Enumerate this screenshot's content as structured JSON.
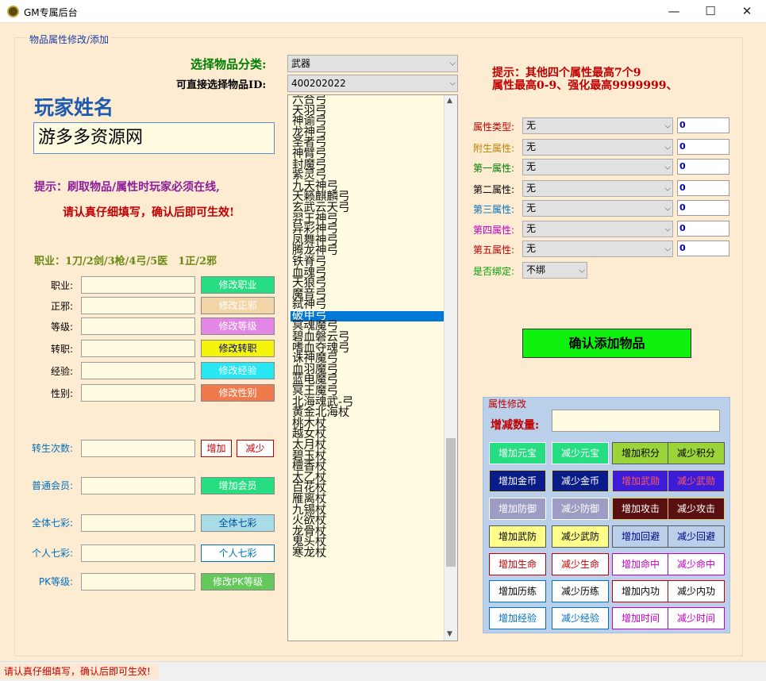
{
  "window": {
    "title": "GM专属后台",
    "minimize": "—",
    "maximize": "☐",
    "close": "✕"
  },
  "group_title": "物品属性修改/添加",
  "category": {
    "label": "选择物品分类:",
    "value": "武器"
  },
  "item_id": {
    "label": "可直接选择物品ID:",
    "value": "400202022"
  },
  "player": {
    "label": "玩家姓名",
    "value": "游多多资源网"
  },
  "notice1": "提示：刷取物品/属性时玩家必须在线,",
  "notice2": "请认真仔细填写，确认后即可生效!",
  "job_hint": "职业：1刀/2剑/3枪/4弓/5医　1正/2邪",
  "fields": [
    {
      "label": "职业:",
      "button": "修改职业",
      "color": "#27dd82"
    },
    {
      "label": "正邪:",
      "button": "修改正邪",
      "color": "#f2d6a8"
    },
    {
      "label": "等级:",
      "button": "修改等级",
      "color": "#e486e6"
    },
    {
      "label": "转职:",
      "button": "修改转职",
      "color": "#f5f50b"
    },
    {
      "label": "经验:",
      "button": "修改经验",
      "color": "#27e8f2"
    },
    {
      "label": "性别:",
      "button": "修改性别",
      "color": "#f07a4c"
    }
  ],
  "rebirth": {
    "label": "转生次数:",
    "add": "增加",
    "sub": "减少"
  },
  "member": {
    "label": "普通会员:",
    "button": "增加会员"
  },
  "all_colors": {
    "label": "全体七彩:",
    "button": "全体七彩"
  },
  "personal_colors": {
    "label": "个人七彩:",
    "button": "个人七彩"
  },
  "pk": {
    "label": "PK等级:",
    "button": "修改PK等级"
  },
  "items": [
    "六合弓",
    "天羽弓",
    "神谕弓",
    "龙神弓",
    "圣者弓",
    "神臂弓",
    "封魔弓",
    "紫灵弓",
    "九天神弓",
    "天籁麒麟弓",
    "玄武云天弓",
    "羿王神弓",
    "异彩神弓",
    "凤舞神弓",
    "腾龙神弓",
    "铁脊弓",
    "血魂弓",
    "天狼弓",
    "魔音弓",
    "弑神弓",
    "破甲弓",
    "冥魂魔弓",
    "碧血磐云弓",
    "嗜血夺魂弓",
    "诛神魔弓",
    "血羽魔弓",
    "蓝电魔弓",
    "冥王魔弓",
    "北海魂武-弓",
    "黄金北海杖",
    "桃木杖",
    "越女杖",
    "太月杖",
    "碧玉杖",
    "檀香杖",
    "太乙杖",
    "百花杖",
    "雁离杖",
    "九锡杖",
    "火欲杖",
    "龙骨杖",
    "鬼头杖",
    "寒龙杖"
  ],
  "selected_item": "破甲弓",
  "hint_right1": "提示：其他四个属性最高7个9",
  "hint_right2": "属性最高0-9、强化最高9999999、",
  "attributes": [
    {
      "label": "属性类型:",
      "value": "无",
      "num": "0",
      "color": "#c00000"
    },
    {
      "label": "附生属性:",
      "value": "无",
      "num": "0",
      "color": "#c08000"
    },
    {
      "label": "第一属性:",
      "value": "无",
      "num": "0",
      "color": "#008000"
    },
    {
      "label": "第二属性:",
      "value": "无",
      "num": "0",
      "color": "#000000"
    },
    {
      "label": "第三属性:",
      "value": "无",
      "num": "0",
      "color": "#0070c0"
    },
    {
      "label": "第四属性:",
      "value": "无",
      "num": "0",
      "color": "#c000c0"
    },
    {
      "label": "第五属性:",
      "value": "无",
      "num": "0",
      "color": "#c00000"
    }
  ],
  "bind": {
    "label": "是否绑定:",
    "value": "不绑",
    "color": "#00a000"
  },
  "confirm_button": "确认添加物品",
  "prop_panel": {
    "title": "属性修改",
    "qty_label": "增减数量:",
    "buttons": [
      {
        "label": "增加元宝",
        "bg": "#27dd82",
        "fg": "#ffffff",
        "border": "#ffffff"
      },
      {
        "label": "减少元宝",
        "bg": "#27dd82",
        "fg": "#ffffff",
        "border": "#ffffff"
      },
      {
        "label": "增加积分",
        "bg": "#9bd43a",
        "fg": "#000000",
        "border": "#555555"
      },
      {
        "label": "减少积分",
        "bg": "#9bd43a",
        "fg": "#000000",
        "border": "#555555"
      },
      {
        "label": "增加金币",
        "bg": "#0a1c88",
        "fg": "#ffffff",
        "border": "#e0d060"
      },
      {
        "label": "减少金币",
        "bg": "#0a1c88",
        "fg": "#ffffff",
        "border": "#e0d060"
      },
      {
        "label": "增加武勋",
        "bg": "#3c1cd8",
        "fg": "#ff5a5a",
        "border": "#e0d060"
      },
      {
        "label": "减少武勋",
        "bg": "#3c1cd8",
        "fg": "#ff5a5a",
        "border": "#e0d060"
      },
      {
        "label": "增加防御",
        "bg": "#9d9dc4",
        "fg": "#ffffff",
        "border": "#ffffff"
      },
      {
        "label": "减少防御",
        "bg": "#9d9dc4",
        "fg": "#ffffff",
        "border": "#ffffff"
      },
      {
        "label": "增加攻击",
        "bg": "#5a1010",
        "fg": "#ffffff",
        "border": "#e0d060"
      },
      {
        "label": "减少攻击",
        "bg": "#5a1010",
        "fg": "#ffffff",
        "border": "#e0d060"
      },
      {
        "label": "增加武防",
        "bg": "#fdfd8a",
        "fg": "#000000",
        "border": "#555555"
      },
      {
        "label": "减少武防",
        "bg": "#fdfd8a",
        "fg": "#000000",
        "border": "#555555"
      },
      {
        "label": "增加回避",
        "bg": "#b9cfea",
        "fg": "#000080",
        "border": "#555555"
      },
      {
        "label": "减少回避",
        "bg": "#b9cfea",
        "fg": "#000080",
        "border": "#555555"
      },
      {
        "label": "增加生命",
        "bg": "#ffffff",
        "fg": "#c00000",
        "border": "#c00000"
      },
      {
        "label": "减少生命",
        "bg": "#ffffff",
        "fg": "#c00000",
        "border": "#c00000"
      },
      {
        "label": "增加命中",
        "bg": "#ffffff",
        "fg": "#c000c0",
        "border": "#c000c0"
      },
      {
        "label": "减少命中",
        "bg": "#ffffff",
        "fg": "#c000c0",
        "border": "#c000c0"
      },
      {
        "label": "增加历练",
        "bg": "#ffffff",
        "fg": "#000000",
        "border": "#0070c0"
      },
      {
        "label": "减少历练",
        "bg": "#ffffff",
        "fg": "#000000",
        "border": "#0070c0"
      },
      {
        "label": "增加内功",
        "bg": "#ffffff",
        "fg": "#000000",
        "border": "#c00000"
      },
      {
        "label": "减少内功",
        "bg": "#ffffff",
        "fg": "#000000",
        "border": "#c00000"
      },
      {
        "label": "增加经验",
        "bg": "#ffffff",
        "fg": "#0070c0",
        "border": "#0070c0"
      },
      {
        "label": "减少经验",
        "bg": "#ffffff",
        "fg": "#0070c0",
        "border": "#0070c0"
      },
      {
        "label": "增加时间",
        "bg": "#ffffff",
        "fg": "#c000c0",
        "border": "#c000c0"
      },
      {
        "label": "减少时间",
        "bg": "#ffffff",
        "fg": "#c000c0",
        "border": "#c000c0"
      }
    ]
  },
  "status": "请认真仔细填写，确认后即可生效!"
}
